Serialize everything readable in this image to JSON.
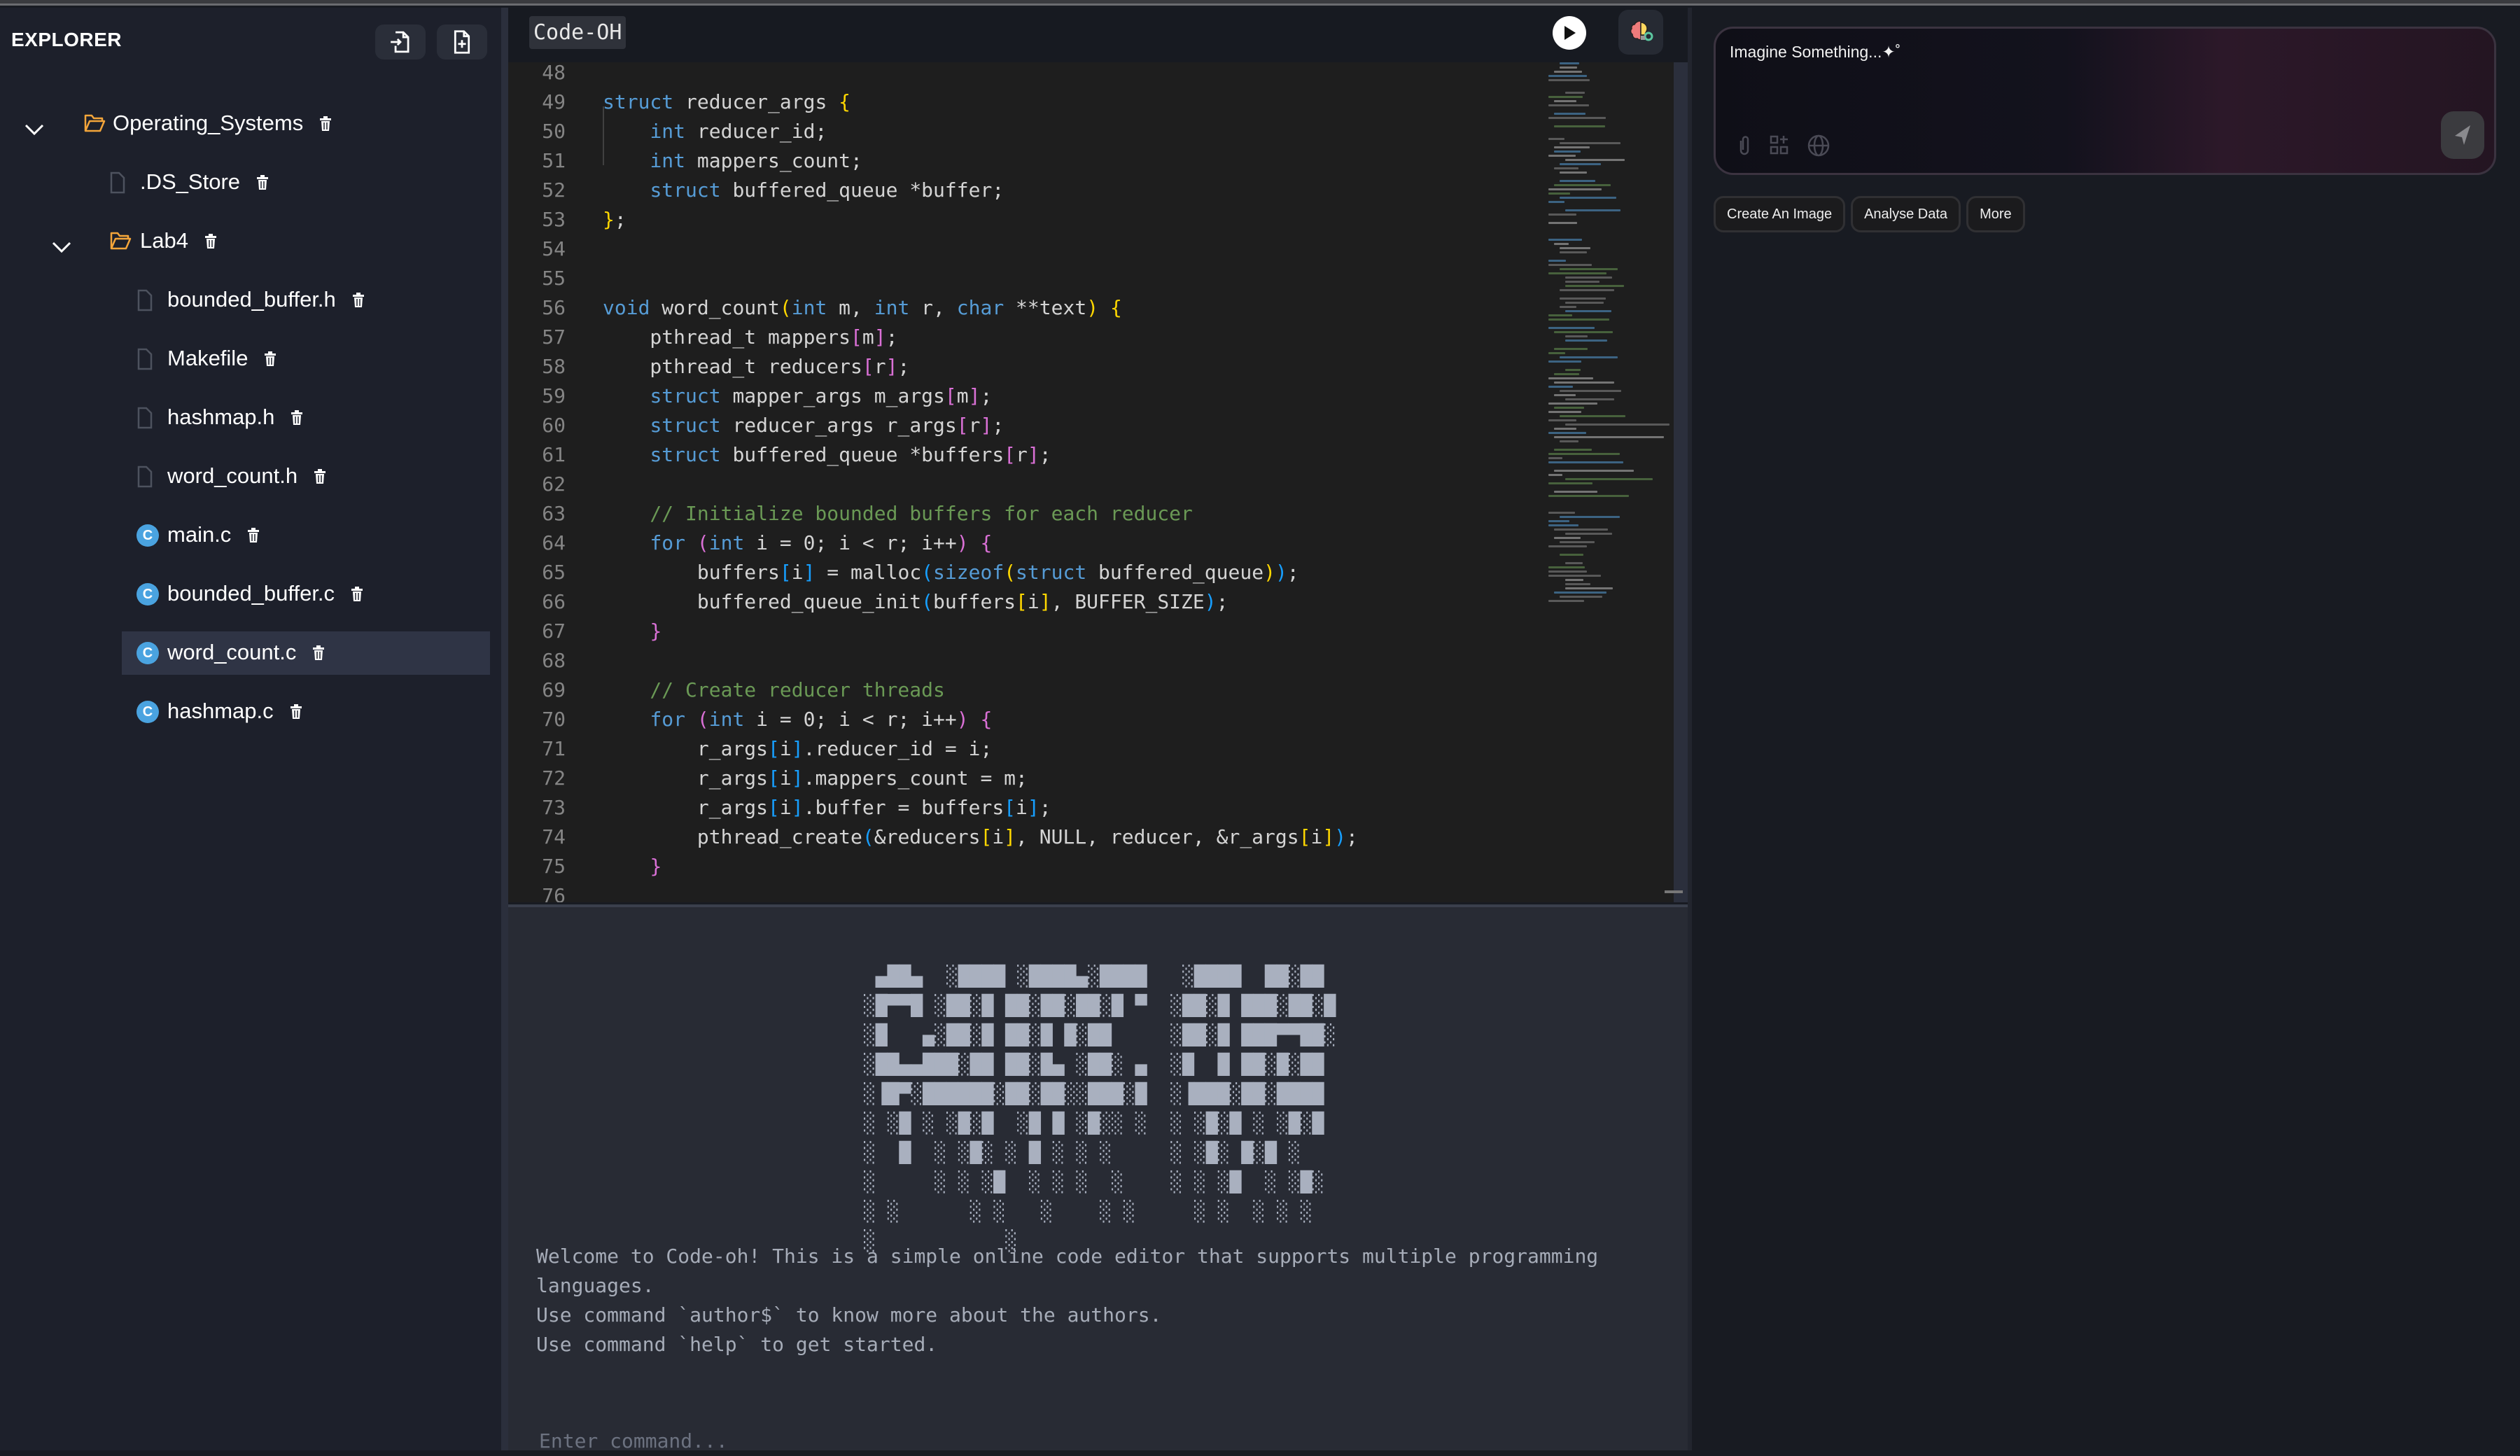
{
  "explorer": {
    "title": "EXPLORER",
    "tree": [
      {
        "label": "Operating_Systems",
        "type": "folder",
        "level": 0,
        "expanded": true
      },
      {
        "label": ".DS_Store",
        "type": "file",
        "level": 1
      },
      {
        "label": "Lab4",
        "type": "folder",
        "level": 1,
        "expanded": true
      },
      {
        "label": "bounded_buffer.h",
        "type": "file",
        "level": 2
      },
      {
        "label": "Makefile",
        "type": "file",
        "level": 2
      },
      {
        "label": "hashmap.h",
        "type": "file",
        "level": 2
      },
      {
        "label": "word_count.h",
        "type": "file",
        "level": 2
      },
      {
        "label": "main.c",
        "type": "c",
        "level": 2
      },
      {
        "label": "bounded_buffer.c",
        "type": "c",
        "level": 2
      },
      {
        "label": "word_count.c",
        "type": "c",
        "level": 2,
        "selected": true
      },
      {
        "label": "hashmap.c",
        "type": "c",
        "level": 2
      }
    ],
    "c_icon_letter": "C"
  },
  "editor": {
    "title": "Code-OH",
    "lines": [
      {
        "n": "48",
        "t": []
      },
      {
        "n": "49",
        "t": [
          [
            "k",
            "struct"
          ],
          [
            "p",
            " reducer_args "
          ],
          [
            "y",
            "{"
          ]
        ]
      },
      {
        "n": "50",
        "t": [
          [
            "p",
            "    "
          ],
          [
            "k",
            "int"
          ],
          [
            "p",
            " reducer_id;"
          ]
        ]
      },
      {
        "n": "51",
        "t": [
          [
            "p",
            "    "
          ],
          [
            "k",
            "int"
          ],
          [
            "p",
            " mappers_count;"
          ]
        ]
      },
      {
        "n": "52",
        "t": [
          [
            "p",
            "    "
          ],
          [
            "k",
            "struct"
          ],
          [
            "p",
            " buffered_queue *buffer;"
          ]
        ]
      },
      {
        "n": "53",
        "t": [
          [
            "y",
            "}"
          ],
          [
            "p",
            ";"
          ]
        ]
      },
      {
        "n": "54",
        "t": []
      },
      {
        "n": "55",
        "t": []
      },
      {
        "n": "56",
        "t": [
          [
            "k",
            "void"
          ],
          [
            "p",
            " word_count"
          ],
          [
            "y",
            "("
          ],
          [
            "k",
            "int"
          ],
          [
            "p",
            " m, "
          ],
          [
            "k",
            "int"
          ],
          [
            "p",
            " r, "
          ],
          [
            "k",
            "char"
          ],
          [
            "p",
            " **text"
          ],
          [
            "y",
            ")"
          ],
          [
            "p",
            " "
          ],
          [
            "y",
            "{"
          ]
        ]
      },
      {
        "n": "57",
        "t": [
          [
            "p",
            "    pthread_t mappers"
          ],
          [
            "m",
            "["
          ],
          [
            "p",
            "m"
          ],
          [
            "m",
            "]"
          ],
          [
            "p",
            ";"
          ]
        ]
      },
      {
        "n": "58",
        "t": [
          [
            "p",
            "    pthread_t reducers"
          ],
          [
            "m",
            "["
          ],
          [
            "p",
            "r"
          ],
          [
            "m",
            "]"
          ],
          [
            "p",
            ";"
          ]
        ]
      },
      {
        "n": "59",
        "t": [
          [
            "p",
            "    "
          ],
          [
            "k",
            "struct"
          ],
          [
            "p",
            " mapper_args m_args"
          ],
          [
            "m",
            "["
          ],
          [
            "p",
            "m"
          ],
          [
            "m",
            "]"
          ],
          [
            "p",
            ";"
          ]
        ]
      },
      {
        "n": "60",
        "t": [
          [
            "p",
            "    "
          ],
          [
            "k",
            "struct"
          ],
          [
            "p",
            " reducer_args r_args"
          ],
          [
            "m",
            "["
          ],
          [
            "p",
            "r"
          ],
          [
            "m",
            "]"
          ],
          [
            "p",
            ";"
          ]
        ]
      },
      {
        "n": "61",
        "t": [
          [
            "p",
            "    "
          ],
          [
            "k",
            "struct"
          ],
          [
            "p",
            " buffered_queue *buffers"
          ],
          [
            "m",
            "["
          ],
          [
            "p",
            "r"
          ],
          [
            "m",
            "]"
          ],
          [
            "p",
            ";"
          ]
        ]
      },
      {
        "n": "62",
        "t": []
      },
      {
        "n": "63",
        "t": [
          [
            "c",
            "    // Initialize bounded buffers for each reducer"
          ]
        ]
      },
      {
        "n": "64",
        "t": [
          [
            "p",
            "    "
          ],
          [
            "k",
            "for"
          ],
          [
            "p",
            " "
          ],
          [
            "m",
            "("
          ],
          [
            "k",
            "int"
          ],
          [
            "p",
            " i = 0; i < r; i++"
          ],
          [
            "m",
            ")"
          ],
          [
            "p",
            " "
          ],
          [
            "m",
            "{"
          ]
        ]
      },
      {
        "n": "65",
        "t": [
          [
            "p",
            "        buffers"
          ],
          [
            "b",
            "["
          ],
          [
            "p",
            "i"
          ],
          [
            "b",
            "]"
          ],
          [
            "p",
            " = malloc"
          ],
          [
            "b",
            "("
          ],
          [
            "k",
            "sizeof"
          ],
          [
            "y",
            "("
          ],
          [
            "k",
            "struct"
          ],
          [
            "p",
            " buffered_queue"
          ],
          [
            "y",
            ")"
          ],
          [
            "b",
            ")"
          ],
          [
            "p",
            ";"
          ]
        ]
      },
      {
        "n": "66",
        "t": [
          [
            "p",
            "        buffered_queue_init"
          ],
          [
            "b",
            "("
          ],
          [
            "p",
            "buffers"
          ],
          [
            "y",
            "["
          ],
          [
            "p",
            "i"
          ],
          [
            "y",
            "]"
          ],
          [
            "p",
            ", BUFFER_SIZE"
          ],
          [
            "b",
            ")"
          ],
          [
            "p",
            ";"
          ]
        ]
      },
      {
        "n": "67",
        "t": [
          [
            "p",
            "    "
          ],
          [
            "m",
            "}"
          ]
        ]
      },
      {
        "n": "68",
        "t": []
      },
      {
        "n": "69",
        "t": [
          [
            "c",
            "    // Create reducer threads"
          ]
        ]
      },
      {
        "n": "70",
        "t": [
          [
            "p",
            "    "
          ],
          [
            "k",
            "for"
          ],
          [
            "p",
            " "
          ],
          [
            "m",
            "("
          ],
          [
            "k",
            "int"
          ],
          [
            "p",
            " i = 0; i < r; i++"
          ],
          [
            "m",
            ")"
          ],
          [
            "p",
            " "
          ],
          [
            "m",
            "{"
          ]
        ]
      },
      {
        "n": "71",
        "t": [
          [
            "p",
            "        r_args"
          ],
          [
            "b",
            "["
          ],
          [
            "p",
            "i"
          ],
          [
            "b",
            "]"
          ],
          [
            "p",
            ".reducer_id = i;"
          ]
        ]
      },
      {
        "n": "72",
        "t": [
          [
            "p",
            "        r_args"
          ],
          [
            "b",
            "["
          ],
          [
            "p",
            "i"
          ],
          [
            "b",
            "]"
          ],
          [
            "p",
            ".mappers_count = m;"
          ]
        ]
      },
      {
        "n": "73",
        "t": [
          [
            "p",
            "        r_args"
          ],
          [
            "b",
            "["
          ],
          [
            "p",
            "i"
          ],
          [
            "b",
            "]"
          ],
          [
            "p",
            ".buffer = buffers"
          ],
          [
            "b",
            "["
          ],
          [
            "p",
            "i"
          ],
          [
            "b",
            "]"
          ],
          [
            "p",
            ";"
          ]
        ]
      },
      {
        "n": "74",
        "t": [
          [
            "p",
            "        pthread_create"
          ],
          [
            "b",
            "("
          ],
          [
            "p",
            "&reducers"
          ],
          [
            "y",
            "["
          ],
          [
            "p",
            "i"
          ],
          [
            "y",
            "]"
          ],
          [
            "p",
            ", NULL, reducer, &r_args"
          ],
          [
            "y",
            "["
          ],
          [
            "p",
            "i"
          ],
          [
            "y",
            "]"
          ],
          [
            "b",
            ")"
          ],
          [
            "p",
            ";"
          ]
        ]
      },
      {
        "n": "75",
        "t": [
          [
            "p",
            "    "
          ],
          [
            "m",
            "}"
          ]
        ]
      },
      {
        "n": "76",
        "t": []
      }
    ]
  },
  "terminal": {
    "logo_art": " ▄██▄  ░████ ░████▄░████   ░████  ██░██\n░█▀▀█ ░██░█ ██░██░██░█ ▀  ░██░█ ███░██░█\n░█   ▄░██░█ ██░█ █░██     ░██░█ ███▀▀██░\n░██▄▄███░██ ██░█▄ ░██░ ▄  ░█  █ ██░█░██\n░▐█▀░██████░██░██░░███░█  ░▐███░██░████\n░ ░█ ░ ░█░█  ░█ █ ░█░░ ░  ░ ░█░█ ░ ░█░█\n░  █  ░ ░█░ ░ █ ░ ░ ░     ░ ░█░ █░█ ░\n░     ░ ░ ░█  ░ ░ ░  ░    ░ ░ ░█  ░ ░█░\n░ ░      ░ ░   ░    ░ ░     ░ ░  ░ ░ ░\n░           ░",
    "lines": [
      "Welcome to Code-oh! This is a simple online code editor that supports multiple programming",
      "languages.",
      "Use command `author$` to know more about the authors.",
      "Use command `help` to get started."
    ],
    "input_placeholder": "Enter command..."
  },
  "assistant": {
    "prompt_placeholder": "Imagine Something...✦˚",
    "chips": [
      "Create An Image",
      "Analyse Data",
      "More"
    ]
  }
}
